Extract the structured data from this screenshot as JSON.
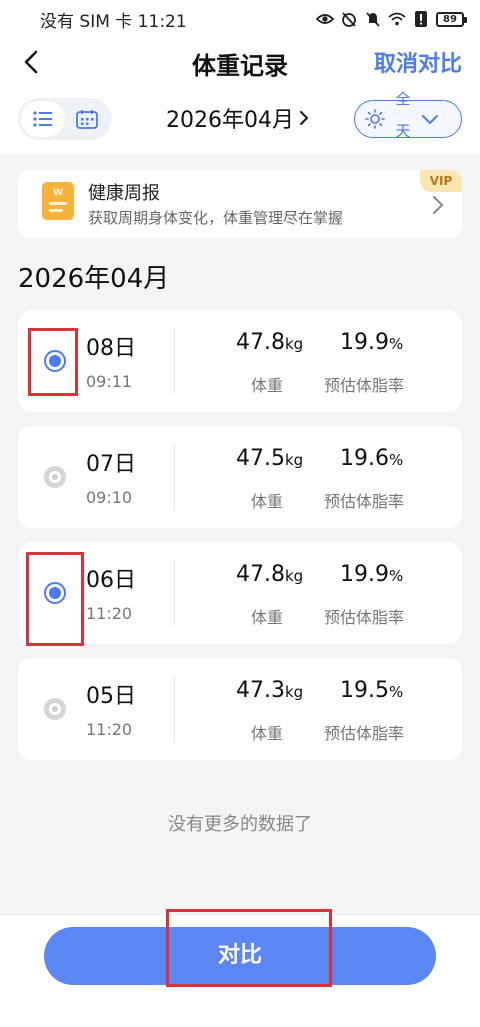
{
  "status_bar": {
    "left_text": "没有 SIM 卡 11:21",
    "battery": "89"
  },
  "header": {
    "title": "体重记录",
    "cancel_compare": "取消对比"
  },
  "toolbar": {
    "month": "2026年04月",
    "period_line1": "全",
    "period_line2": "天"
  },
  "promo": {
    "title": "健康周报",
    "subtitle": "获取周期身体变化，体重管理尽在掌握",
    "badge": "VIP"
  },
  "month_heading": "2026年04月",
  "weight_label": "体重",
  "fat_label": "预估体脂率",
  "weight_unit": "kg",
  "fat_unit": "%",
  "records": [
    {
      "day": "08日",
      "time": "09:11",
      "weight": "47.8",
      "fat": "19.9",
      "checked": true
    },
    {
      "day": "07日",
      "time": "09:10",
      "weight": "47.5",
      "fat": "19.6",
      "checked": false
    },
    {
      "day": "06日",
      "time": "11:20",
      "weight": "47.8",
      "fat": "19.9",
      "checked": true
    },
    {
      "day": "05日",
      "time": "11:20",
      "weight": "47.3",
      "fat": "19.5",
      "checked": false
    }
  ],
  "no_more_text": "没有更多的数据了",
  "compare_button": "对比",
  "colors": {
    "accent": "#4b7bf5",
    "button": "#5c86f2",
    "highlight": "#d9333a"
  }
}
